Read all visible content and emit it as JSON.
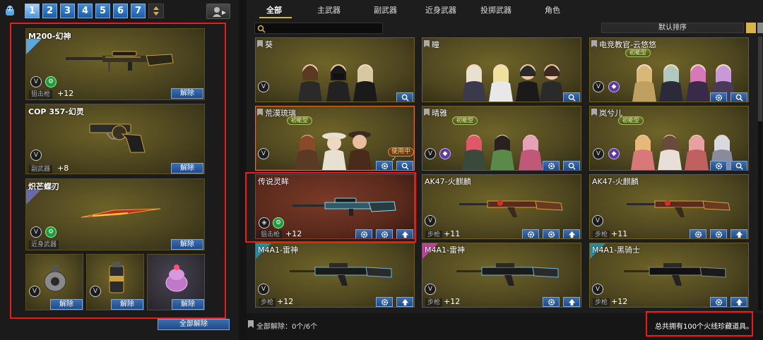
{
  "left_panel": {
    "pages": [
      "1",
      "2",
      "3",
      "4",
      "5",
      "6",
      "7"
    ],
    "active_page": "1",
    "slots": [
      {
        "title": "M200-幻神",
        "category": "狙击枪",
        "plus": "+12",
        "remove": "解除"
      },
      {
        "title": "COP 357-幻灵",
        "category": "副武器",
        "plus": "+8",
        "remove": "解除"
      },
      {
        "title": "炽芒蝶刃",
        "category": "近身武器",
        "plus": "",
        "remove": "解除"
      }
    ],
    "small_slots": [
      {
        "name": "grenade",
        "remove": "解除"
      },
      {
        "name": "smoke",
        "remove": "解除"
      },
      {
        "name": "flash",
        "remove": "解除"
      }
    ],
    "clear_all": "全部解除"
  },
  "tabs": [
    "全部",
    "主武器",
    "副武器",
    "近身武器",
    "投掷武器",
    "角色"
  ],
  "active_tab": "全部",
  "search": {
    "placeholder": ""
  },
  "sort": {
    "label": "默认排序"
  },
  "cards": [
    {
      "title": "葵",
      "type": "character",
      "label": "",
      "in_use": ""
    },
    {
      "title": "瞳",
      "type": "character",
      "label": "",
      "in_use": ""
    },
    {
      "title": "电竞教官-云悠悠",
      "type": "character",
      "label": "初能型",
      "in_use": ""
    },
    {
      "title": "荒漠琉璃",
      "type": "character",
      "label": "初能型",
      "in_use": "使用中✓"
    },
    {
      "title": "晴雅",
      "type": "character",
      "label": "初能型",
      "in_use": ""
    },
    {
      "title": "岚兮儿",
      "type": "character",
      "label": "初能型",
      "in_use": ""
    },
    {
      "title": "传说灵眸",
      "type": "weapon",
      "category": "狙击枪",
      "plus": "+12"
    },
    {
      "title": "AK47-火麒麟",
      "type": "weapon",
      "category": "步枪",
      "plus": "+11"
    },
    {
      "title": "AK47-火麒麟",
      "type": "weapon",
      "category": "步枪",
      "plus": "+11"
    },
    {
      "title": "M4A1-雷神",
      "type": "weapon",
      "category": "步枪",
      "plus": "+12"
    },
    {
      "title": "M4A1-雷神",
      "type": "weapon",
      "category": "步枪",
      "plus": "+12"
    },
    {
      "title": "M4A1-黑骑士",
      "type": "weapon",
      "category": "步枪",
      "plus": "+12"
    }
  ],
  "footer": {
    "clear_status": "全部解除：0个/6个",
    "total": "总共拥有100个火线珍藏道具。"
  },
  "colors": {
    "accent": "#d8b24a",
    "button": "#1e4b88",
    "highlight": "#f01818"
  }
}
